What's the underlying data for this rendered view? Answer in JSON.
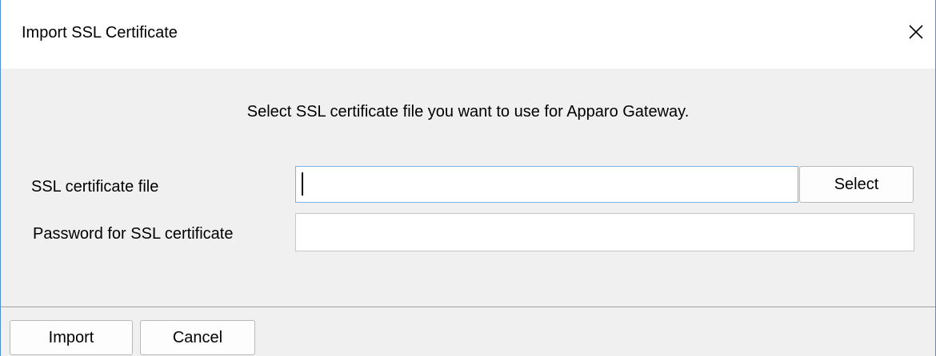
{
  "dialog": {
    "title": "Import SSL Certificate",
    "close_icon": "close-icon",
    "message": "Select SSL certificate file you want to use for Apparo Gateway."
  },
  "form": {
    "cert_file_label": "SSL certificate file",
    "cert_file_value": "",
    "select_button": "Select",
    "password_label": "Password for SSL certificate",
    "password_value": ""
  },
  "footer": {
    "import_button": "Import",
    "cancel_button": "Cancel"
  }
}
